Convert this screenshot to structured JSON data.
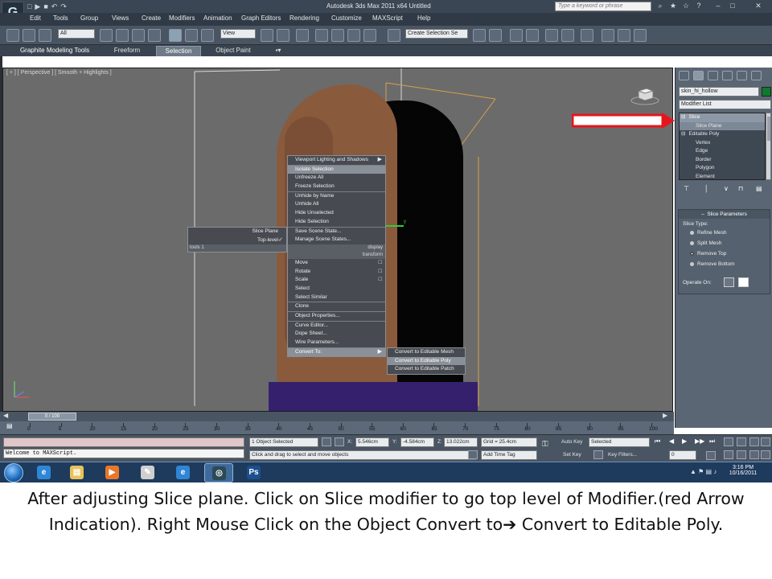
{
  "window": {
    "title": "Autodesk 3ds Max  2011 x64     Untitled",
    "help_search_placeholder": "Type a keyword or phrase"
  },
  "menubar": [
    "Edit",
    "Tools",
    "Group",
    "Views",
    "Create",
    "Modifiers",
    "Animation",
    "Graph Editors",
    "Rendering",
    "Customize",
    "MAXScript",
    "Help"
  ],
  "toolbar": {
    "selection_filter": "All",
    "reference_coord": "View",
    "named_selection": "Create Selection Se"
  },
  "ribbon_tabs": [
    "Graphite Modeling Tools",
    "Freeform",
    "Selection",
    "Object Paint"
  ],
  "ribbon_active_tab": "Selection",
  "viewport": {
    "label": "[ + ] [ Perspective ] [ Smooth + Highlights ]"
  },
  "quad_menu": {
    "main_top": [
      {
        "label": "Viewport Lighting and Shadows",
        "arrow": "▶"
      },
      {
        "label": "Isolate Selection",
        "highlighted": true
      },
      {
        "label": "Unfreeze All"
      },
      {
        "label": "Freeze Selection"
      },
      {
        "label": "Unhide by Name"
      },
      {
        "label": "Unhide All"
      },
      {
        "label": "Hide Unselected"
      },
      {
        "label": "Hide Selection"
      },
      {
        "label": "Save Scene State..."
      },
      {
        "label": "Manage Scene States..."
      }
    ],
    "display_header": "display",
    "transform_header": "transform",
    "tools_header": "tools 1",
    "main_bottom": [
      {
        "label": "Move",
        "mark": "□"
      },
      {
        "label": "Rotate",
        "mark": "□"
      },
      {
        "label": "Scale",
        "mark": "□"
      },
      {
        "label": "Select"
      },
      {
        "label": "Select Similar"
      },
      {
        "label": "Clone"
      },
      {
        "label": "Object Properties..."
      },
      {
        "label": "Curve Editor..."
      },
      {
        "label": "Dope Sheet..."
      },
      {
        "label": "Wire Parameters..."
      },
      {
        "label": "Convert To:",
        "arrow": "▶",
        "highlighted": true
      }
    ],
    "left_items": [
      {
        "label": "Slice Plane"
      },
      {
        "label": "Top-level",
        "mark": "✓"
      }
    ],
    "convert_submenu": [
      {
        "label": "Convert to Editable Mesh"
      },
      {
        "label": "Convert to Editable Poly",
        "highlighted": true
      },
      {
        "label": "Convert to Editable Patch"
      }
    ]
  },
  "command_panel": {
    "object_name": "skin_hi_hollow",
    "object_color": "#0d7a2e",
    "modifier_list": "Modifier List",
    "stack": [
      {
        "label": "Slice",
        "prefix": "⊟",
        "selected": true
      },
      {
        "label": "Slice Plane",
        "prefix": "",
        "sub": true
      },
      {
        "label": "Editable Poly",
        "prefix": "⊟"
      },
      {
        "label": "Vertex",
        "prefix": ""
      },
      {
        "label": "Edge",
        "prefix": ""
      },
      {
        "label": "Border",
        "prefix": ""
      },
      {
        "label": "Polygon",
        "prefix": ""
      },
      {
        "label": "Element",
        "prefix": ""
      }
    ],
    "rollout": {
      "title": "Slice Parameters",
      "slice_type_label": "Slice Type:",
      "options": [
        {
          "label": "Refine Mesh",
          "checked": false
        },
        {
          "label": "Split Mesh",
          "checked": false
        },
        {
          "label": "Remove Top",
          "checked": true
        },
        {
          "label": "Remove Bottom",
          "checked": false
        }
      ],
      "operate_on_label": "Operate On:"
    }
  },
  "annotation": {
    "arrow_color": "#e8141c"
  },
  "timeline": {
    "frame_display": "0 / 100",
    "ruler_labels": [
      "0",
      "5",
      "10",
      "15",
      "20",
      "25",
      "30",
      "35",
      "40",
      "45",
      "50",
      "55",
      "60",
      "65",
      "70",
      "75",
      "80",
      "85",
      "90",
      "95",
      "100"
    ]
  },
  "status": {
    "maxscript_output": "Welcome to MAXScript.",
    "selection": "1 Object Selected",
    "prompt": "Click and drag to select and move objects",
    "x_label": "X:",
    "x": "5.546cm",
    "y_label": "Y:",
    "y": "-4.584cm",
    "z_label": "Z:",
    "z": "13.022cm",
    "grid": "Grid = 25.4cm",
    "auto_key": "Auto Key",
    "set_key": "Set Key",
    "key_mode": "Selected",
    "add_time_tag": "Add Time Tag",
    "key_filters": "Key Filters...",
    "current_frame": "0"
  },
  "taskbar": {
    "apps": [
      {
        "name": "internet-explorer",
        "glyph": "e",
        "color": "#2f86d6",
        "active": false
      },
      {
        "name": "windows-explorer",
        "glyph": "▤",
        "color": "#e8c25a",
        "active": false
      },
      {
        "name": "media-player",
        "glyph": "▶",
        "color": "#e8772a",
        "active": false
      },
      {
        "name": "wacom",
        "glyph": "✎",
        "color": "#cfcfcf",
        "active": false
      },
      {
        "name": "internet-explorer-2",
        "glyph": "e",
        "color": "#2f86d6",
        "active": false
      },
      {
        "name": "3ds-max",
        "glyph": "◎",
        "color": "#2c4a55",
        "active": true
      },
      {
        "name": "photoshop",
        "glyph": "Ps",
        "color": "#1b4f8f",
        "active": false
      }
    ],
    "time": "3:16 PM",
    "date": "10/16/2011"
  },
  "caption": {
    "part1": "After adjusting Slice plane. Click on Slice modifier to go top level of Modifier.(red Arrow Indication). Right Mouse Click on the Object Convert to",
    "arrow": "➔",
    "part2": " Convert to Editable Poly."
  }
}
